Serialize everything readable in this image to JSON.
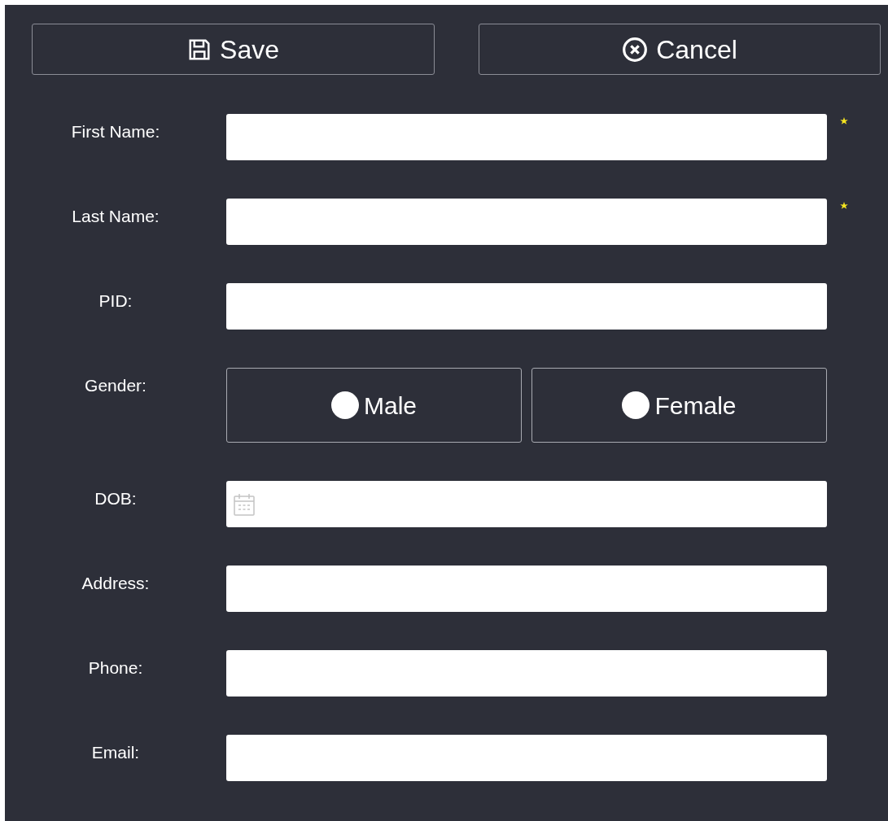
{
  "toolbar": {
    "buttons": [
      {
        "label": "Save",
        "kind": "save"
      },
      {
        "label": "Cancel",
        "kind": "cancel"
      }
    ]
  },
  "fields": [
    {
      "label": "First Name:",
      "kind": "text",
      "required": true
    },
    {
      "label": "Last Name:",
      "kind": "text",
      "required": true
    },
    {
      "label": "PID:",
      "kind": "text",
      "required": false
    },
    {
      "label": "Gender:",
      "kind": "radio",
      "required": false,
      "options": [
        {
          "label": "Male",
          "selected": false
        },
        {
          "label": "Female",
          "selected": false
        }
      ]
    },
    {
      "label": "DOB:",
      "kind": "date",
      "required": false
    },
    {
      "label": "Address:",
      "kind": "text",
      "required": false
    },
    {
      "label": "Phone:",
      "kind": "text",
      "required": false
    },
    {
      "label": "Email:",
      "kind": "text",
      "required": false
    }
  ]
}
